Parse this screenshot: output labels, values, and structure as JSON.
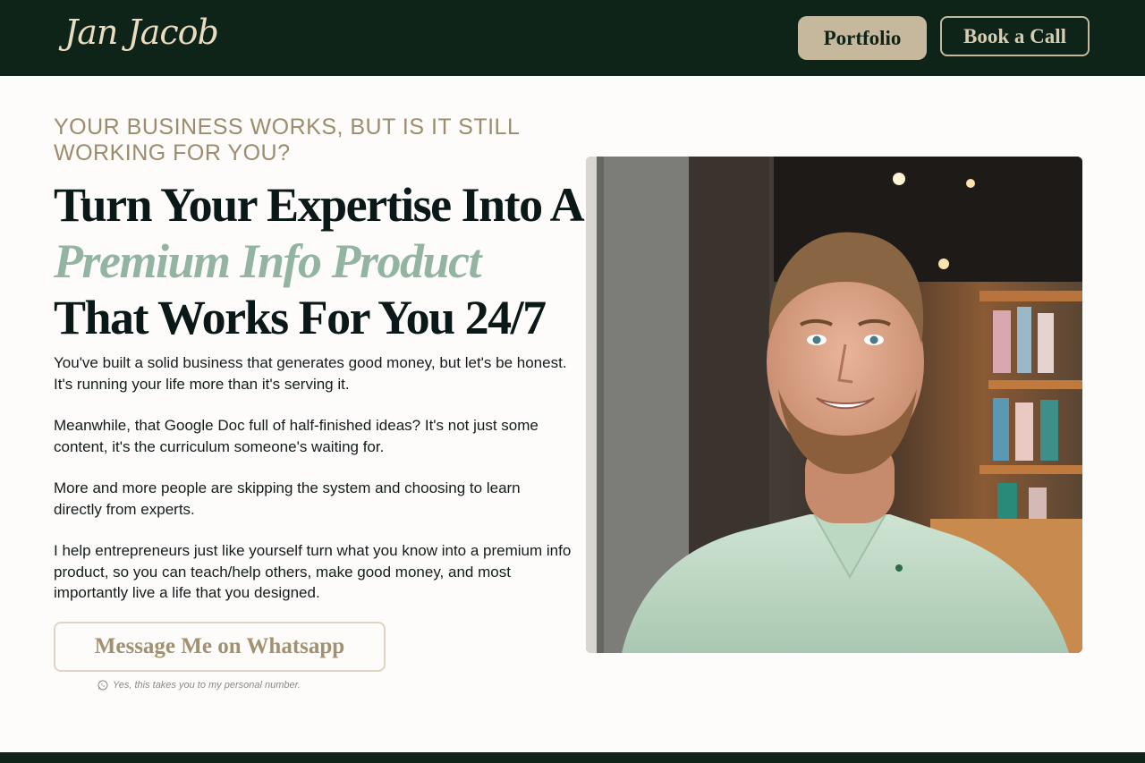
{
  "header": {
    "logo": "Jan Jacob",
    "nav": {
      "portfolio_label": "Portfolio",
      "book_call_label": "Book a Call"
    }
  },
  "hero": {
    "eyebrow": "YOUR BUSINESS WORKS, BUT IS IT STILL WORKING FOR YOU?",
    "headline": {
      "line1": "Turn Your Expertise Into A",
      "line2_accent": "Premium Info Product",
      "line3": "That Works For You 24/7"
    },
    "paragraphs": [
      "You've built a solid business that generates good money, but let's be honest. It's running your life more than it's serving it.",
      "Meanwhile, that Google Doc full of half-finished ideas? It's not just some content, it's the curriculum someone's waiting for.",
      "More and more people are skipping the system and choosing to learn directly from experts.",
      "I help entrepreneurs just like yourself turn what you know into a premium info product, so you can teach/help others, make good money, and most importantly live a life that you designed."
    ],
    "cta": {
      "whatsapp_label": "Message Me on Whatsapp",
      "note": "Yes, this takes you to my personal number.",
      "note_icon": "whatsapp-icon"
    },
    "photo": {
      "subject": "portrait-photo"
    }
  },
  "colors": {
    "dark_green": "#0e2418",
    "gold": "#c6b89d",
    "accent_green": "#93b4a1",
    "eyebrow_tan": "#9d8c6c"
  }
}
